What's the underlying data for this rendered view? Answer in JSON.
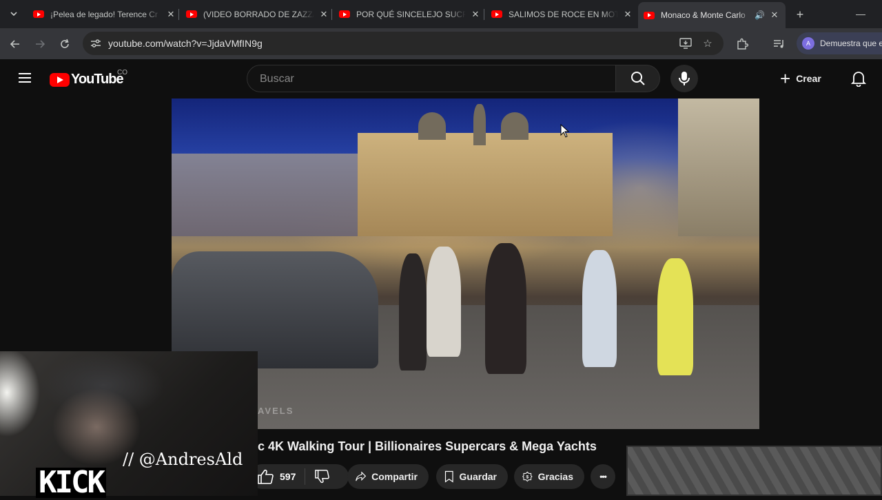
{
  "browser": {
    "tabs": [
      {
        "title": "¡Pelea de legado! Terence Cr",
        "active": false
      },
      {
        "title": "(VIDEO BORRADO DE ZAZZA",
        "active": false
      },
      {
        "title": "POR QUÉ SINCELEJO SUCRE",
        "active": false
      },
      {
        "title": "SALIMOS DE ROCE EN MOTO",
        "active": false
      },
      {
        "title": "Monaco & Monte Carlo",
        "active": true,
        "audio": "🔊"
      }
    ],
    "url": "youtube.com/watch?v=JjdaVMfIN9g",
    "profile_label": "Demuestra que e",
    "profile_initial": "A"
  },
  "youtube": {
    "logo_text": "YouTube",
    "country_code": "CO",
    "search_placeholder": "Buscar",
    "create_label": "Crear"
  },
  "video": {
    "watermark": "AVELS",
    "title": "c 4K Walking Tour | Billionaires Supercars & Mega Yachts",
    "likes": "597",
    "share_label": "Compartir",
    "save_label": "Guardar",
    "thanks_label": "Gracias",
    "more_label": "•••"
  },
  "overlay": {
    "handle": "// @AndresAld",
    "brand": "KICK"
  },
  "colors": {
    "youtube_red": "#ff0000",
    "page_bg": "#0f0f0f",
    "tab_bar": "#202124",
    "active_tab": "#35363a"
  }
}
